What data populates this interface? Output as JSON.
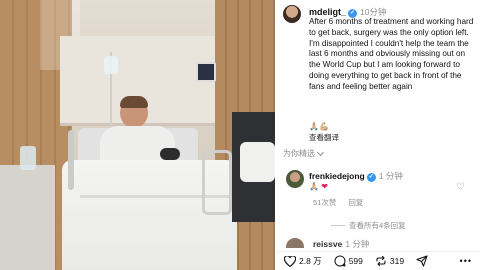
{
  "post": {
    "username": "mdeligt_",
    "time": "10分钟",
    "caption": "After 6 months of treatment and working hard to get back, surgery was the only option left. I'm disappointed I couldn't help the team the last 6 months and obviously missing out on the World Cup but I am looking forward to doing everything to get back in front of the fans and feeling better again",
    "emoji": "🙏🏼💪🏼",
    "translate_label": "查看翻译"
  },
  "comments_section": {
    "title": "为你精选"
  },
  "comment": {
    "username": "frenkiedejong",
    "time": "1 分钟",
    "emoji": "🙏🏼",
    "likes": "51次赞",
    "reply_label": "回复",
    "view_replies": "查看所有4条回复"
  },
  "comment2": {
    "username": "reissve",
    "time": "1 分钟"
  },
  "actions": {
    "likes_count": "2.8 万",
    "comments_count": "599",
    "shares_count": "319",
    "more": "•••"
  }
}
